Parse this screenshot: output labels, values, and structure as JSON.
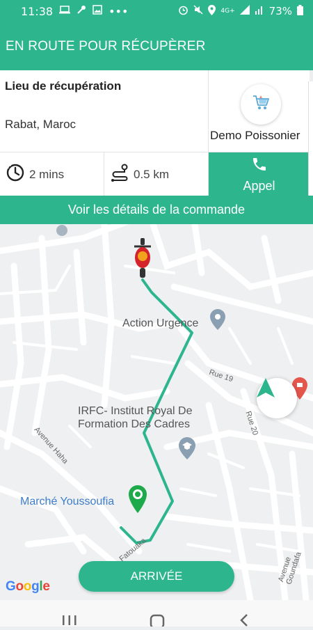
{
  "status_bar": {
    "time": "11:38",
    "battery": "73%",
    "network": "4G+",
    "dots": "•••"
  },
  "app_bar": {
    "title": "EN ROUTE POUR RÉCUPÈRER"
  },
  "pickup": {
    "label": "Lieu de récupération",
    "city": "Rabat, Maroc"
  },
  "store": {
    "name": "Demo Poissonier",
    "avatar_icon": "shopping-cart-icon"
  },
  "metrics": {
    "time": "2 mins",
    "distance": "0.5 km"
  },
  "call_button": {
    "label": "Appel"
  },
  "details_button": {
    "label": "Voir les détails de la commande"
  },
  "map": {
    "places": [
      {
        "name": "Action Urgence"
      },
      {
        "name": "IRFC- Institut Royal De\nFormation Des Cadres"
      },
      {
        "name": "Marché Youssoufia"
      }
    ],
    "roads": [
      "Rue 19",
      "Rue 20",
      "Avenue Haha",
      "Fatouaka",
      "Avenue Goundafa"
    ],
    "route_color": "#2db58e",
    "attribution": "Google"
  },
  "arrive_button": {
    "label": "ARRIVÉE"
  },
  "colors": {
    "accent": "#2db58e",
    "background": "#eceeef"
  }
}
